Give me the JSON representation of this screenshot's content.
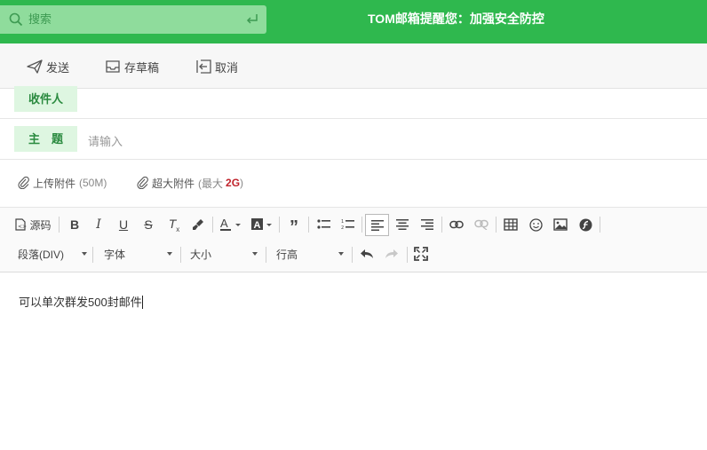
{
  "search": {
    "placeholder": "搜索"
  },
  "header": {
    "notice": "TOM邮箱提醒您：加强安全防控"
  },
  "toolbar": {
    "send": "发送",
    "draft": "存草稿",
    "cancel": "取消"
  },
  "compose": {
    "recipient_label": "收件人",
    "subject_label": "主　题",
    "subject_placeholder": "请输入"
  },
  "attachments": {
    "upload_label": "上传附件",
    "upload_limit": "(50M)",
    "large_label": "超大附件",
    "large_open": "(最大",
    "large_size": "2G",
    "large_close": ")"
  },
  "editor": {
    "source_label": "源码",
    "paragraph": "段落(DIV)",
    "font": "字体",
    "size": "大小",
    "line_height": "行高",
    "content": "可以单次群发500封邮件"
  },
  "colors": {
    "brand_green": "#2fb84e",
    "tag_bg": "#def6e1",
    "tag_text": "#2a8a3f"
  }
}
